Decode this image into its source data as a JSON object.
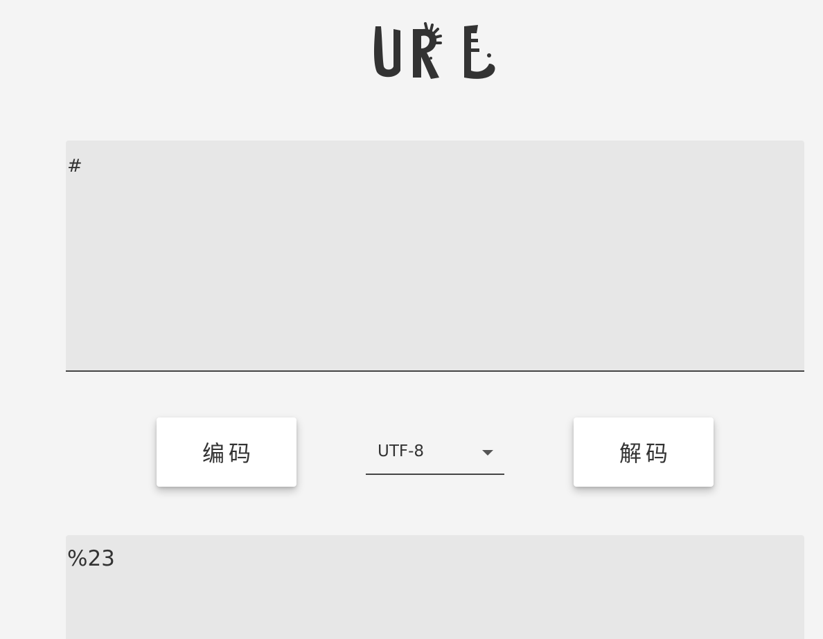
{
  "header": {
    "logo_text": "URL"
  },
  "input": {
    "value": "#",
    "placeholder": ""
  },
  "actions": {
    "encode_label": "编码",
    "decode_label": "解码"
  },
  "charset": {
    "selected": "UTF-8",
    "icon": "chevron-down-icon"
  },
  "output": {
    "value": "%23",
    "placeholder": ""
  },
  "colors": {
    "background": "#f4f4f4",
    "field": "#e7e7e7",
    "text": "#333333",
    "button": "#ffffff"
  }
}
